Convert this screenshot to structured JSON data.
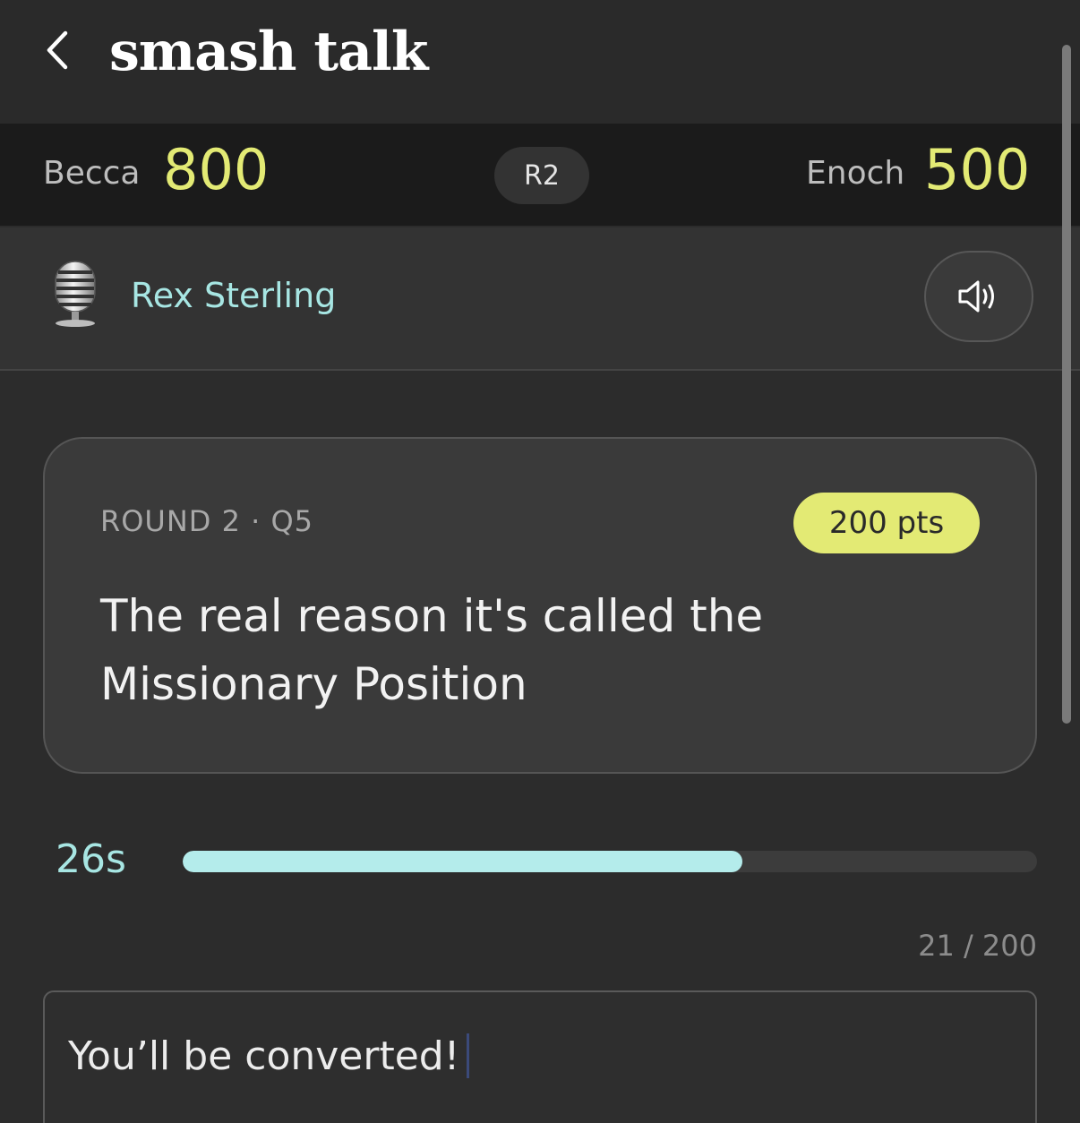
{
  "header": {
    "title": "smash talk",
    "back_icon": "chevron-left-icon"
  },
  "scoreboard": {
    "player1": {
      "name": "Becca",
      "score": "800"
    },
    "player2": {
      "name": "Enoch",
      "score": "500"
    },
    "round_pill": "R2"
  },
  "host": {
    "icon": "microphone-icon",
    "name": "Rex Sterling",
    "sound_icon": "speaker-icon"
  },
  "question": {
    "round_label": "ROUND 2 · Q5",
    "points": "200 pts",
    "text": "The real reason it's called the Missionary Position"
  },
  "timer": {
    "label": "26s",
    "progress": 0.655
  },
  "answer": {
    "char_count": "21 / 200",
    "value": "You’ll be converted!"
  },
  "colors": {
    "accent_yellow": "#e3ea74",
    "accent_cyan": "#a7e6e3",
    "timer_fill": "#b4eceb",
    "background": "#2c2c2c",
    "scoreboard_bg": "#1b1b1b",
    "card_bg": "#3a3a3a"
  }
}
